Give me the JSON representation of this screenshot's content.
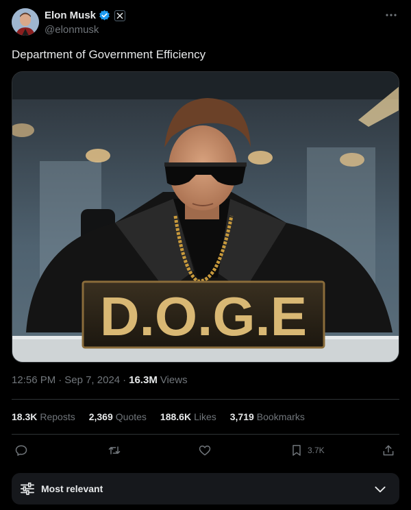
{
  "author": {
    "display_name": "Elon Musk",
    "handle": "@elonmusk"
  },
  "tweet": {
    "text": "Department of Government Efficiency",
    "image_sign_text": "D.O.G.E"
  },
  "meta": {
    "time": "12:56 PM",
    "separator1": "·",
    "date": "Sep 7, 2024",
    "separator2": "·",
    "views_count": "16.3M",
    "views_label": "Views"
  },
  "stats": [
    {
      "value": "18.3K",
      "label": "Reposts"
    },
    {
      "value": "2,369",
      "label": "Quotes"
    },
    {
      "value": "188.6K",
      "label": "Likes"
    },
    {
      "value": "3,719",
      "label": "Bookmarks"
    }
  ],
  "actions": {
    "bookmark_count": "3.7K"
  },
  "sort": {
    "label": "Most relevant"
  },
  "colors": {
    "background": "#000000",
    "text_primary": "#e7e9ea",
    "text_secondary": "#71767b",
    "verified_blue": "#1d9bf0",
    "divider": "#2f3336",
    "sort_bar": "#16181c"
  }
}
